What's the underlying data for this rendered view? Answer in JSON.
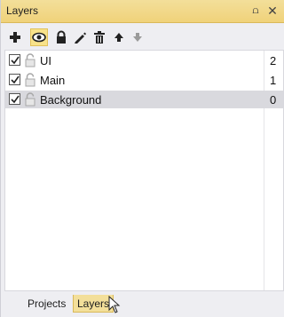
{
  "panel": {
    "title": "Layers",
    "pin_glyph": "⩍",
    "close_glyph": "✕"
  },
  "toolbar": {
    "tools": [
      {
        "icon": "plus-icon",
        "active": false
      },
      {
        "icon": "eye-icon",
        "active": true
      },
      {
        "icon": "lock-icon",
        "active": false
      },
      {
        "icon": "pencil-icon",
        "active": false
      },
      {
        "icon": "trash-icon",
        "active": false
      },
      {
        "icon": "arrow-up-icon",
        "active": false
      },
      {
        "icon": "arrow-down-icon",
        "active": false
      }
    ]
  },
  "layers": [
    {
      "name": "UI",
      "order": "2",
      "visible": true,
      "locked": false,
      "selected": false
    },
    {
      "name": "Main",
      "order": "1",
      "visible": true,
      "locked": false,
      "selected": false
    },
    {
      "name": "Background",
      "order": "0",
      "visible": true,
      "locked": false,
      "selected": true
    }
  ],
  "tabs": [
    {
      "label": "Projects",
      "active": false
    },
    {
      "label": "Layers",
      "active": true
    }
  ],
  "colors": {
    "accent": "#f0d27a",
    "selection": "#d9d9de"
  }
}
